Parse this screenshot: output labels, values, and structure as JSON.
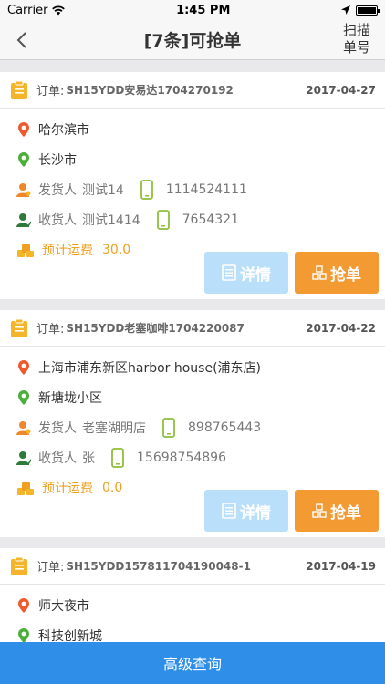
{
  "status": {
    "carrier": "Carrier",
    "time": "1:45 PM"
  },
  "nav": {
    "title": "[7条]可抢单",
    "scan_line1": "扫描",
    "scan_line2": "单号"
  },
  "labels": {
    "order_prefix": "订单:",
    "shipper": "发货人",
    "receiver": "收货人",
    "fee": "预计运费",
    "detail_btn": "详情",
    "grab_btn": "抢单"
  },
  "orders": [
    {
      "order_no": "SH15YDD安易达1704270192",
      "date": "2017-04-27",
      "from": "哈尔滨市",
      "to": "长沙市",
      "shipper_name": "测试14",
      "shipper_phone": "1114524111",
      "receiver_name": "测试1414",
      "receiver_phone": "7654321",
      "fee": "30.0"
    },
    {
      "order_no": "SH15YDD老塞咖啡1704220087",
      "date": "2017-04-22",
      "from": "上海市浦东新区harbor house(浦东店)",
      "to": "新塘垅小区",
      "shipper_name": "老塞湖明店",
      "shipper_phone": "898765443",
      "receiver_name": "张",
      "receiver_phone": "15698754896",
      "fee": "0.0"
    },
    {
      "order_no": "SH15YDD157811704190048-1",
      "date": "2017-04-19",
      "from": "师大夜市",
      "to": "科技创新城"
    }
  ],
  "bottom": {
    "label": "高级查询"
  },
  "colors": {
    "accent": "#2f8fe8",
    "grab": "#f39a33",
    "detail": "#b9dffb",
    "fee": "#f0a020"
  }
}
